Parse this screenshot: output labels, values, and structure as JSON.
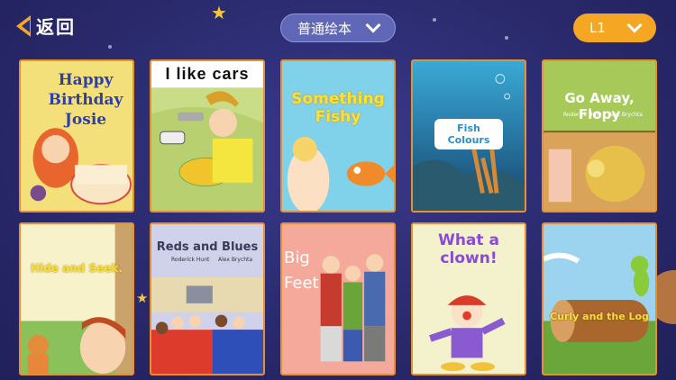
{
  "header": {
    "back_label": "返回",
    "category_label": "普通绘本",
    "level_label": "L1"
  },
  "books": [
    {
      "title": "Happy Birthday Josie"
    },
    {
      "title": "I like cars"
    },
    {
      "title": "Something Fishy"
    },
    {
      "title": "Fish Colours"
    },
    {
      "title": "Go Away, Flopy",
      "author_left": "Roderick Hunt",
      "author_right": "Alex Brychta"
    },
    {
      "title": "Hide and Seek."
    },
    {
      "title": "Reds and Blues",
      "author_left": "Roderick Hunt",
      "author_right": "Alex Brychta"
    },
    {
      "title": "Big Feet"
    },
    {
      "title": "What a clown!"
    },
    {
      "title": "Curly and the Log"
    }
  ]
}
